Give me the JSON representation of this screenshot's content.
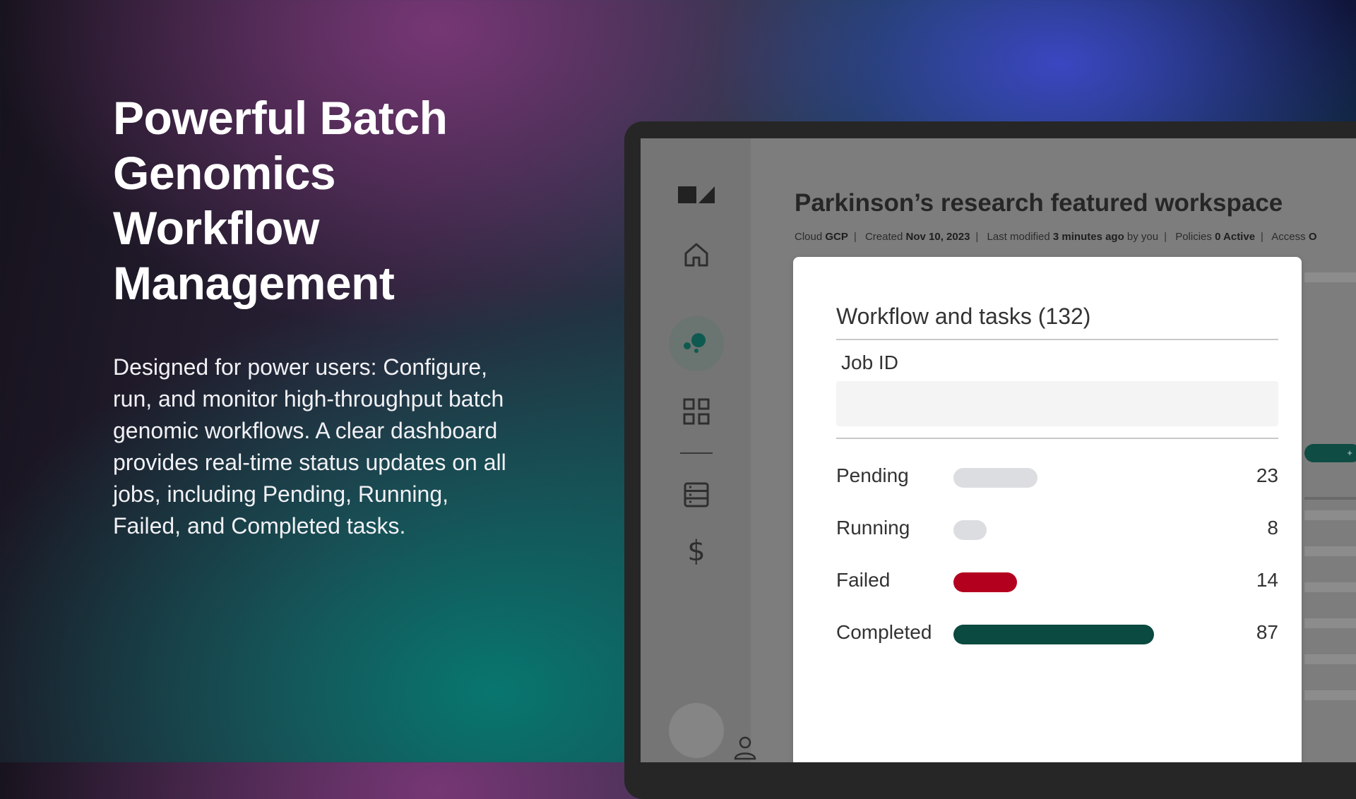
{
  "hero": {
    "title": "Powerful Batch Genomics Workflow Management",
    "description": "Designed for power users: Configure, run, and monitor high-throughput batch genomic workflows. A clear dashboard provides real-time status updates on all jobs, including Pending, Running, Failed, and Completed tasks."
  },
  "sidebar": {
    "items": [
      {
        "icon": "home-icon"
      },
      {
        "icon": "workflow-icon",
        "active": true
      },
      {
        "icon": "grid-icon"
      },
      {
        "icon": "table-icon"
      },
      {
        "icon": "dollar-icon",
        "glyph": "$"
      }
    ]
  },
  "workspace": {
    "title": "Parkinson’s research featured workspace",
    "meta": {
      "cloud_label": "Cloud",
      "cloud_value": "GCP",
      "created_label": "Created",
      "created_value": "Nov 10, 2023",
      "modified_label": "Last modified",
      "modified_value": "3 minutes ago",
      "modified_suffix": "by you",
      "policies_label": "Policies",
      "policies_value": "0 Active",
      "access_label": "Access",
      "access_value": "O"
    }
  },
  "card": {
    "title": "Workflow and tasks (132)",
    "job_id_label": "Job ID",
    "job_id_value": "",
    "statuses": [
      {
        "label": "Pending",
        "count": "23",
        "color": "#dcdde0",
        "fill": 0.33
      },
      {
        "label": "Running",
        "count": "8",
        "color": "#dcdde0",
        "fill": 0.13
      },
      {
        "label": "Failed",
        "count": "14",
        "color": "#b4001f",
        "fill": 0.25
      },
      {
        "label": "Completed",
        "count": "87",
        "color": "#0a4a40",
        "fill": 0.79
      }
    ]
  },
  "colors": {
    "accent_teal": "#0a4a40",
    "failed_red": "#b4001f",
    "pending_gray": "#dcdde0"
  }
}
